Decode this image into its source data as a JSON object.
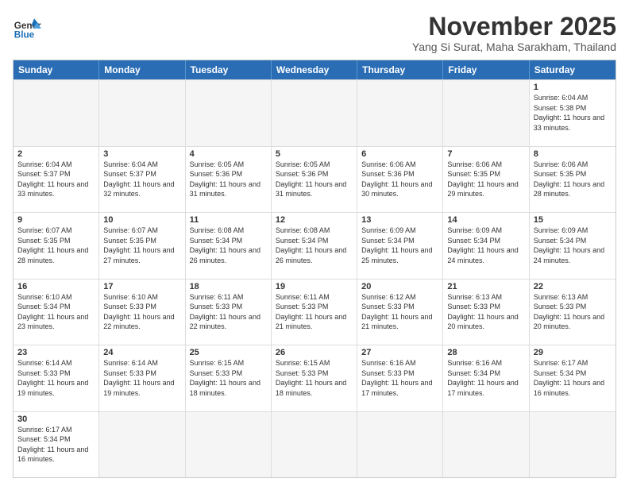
{
  "logo": {
    "general": "General",
    "blue": "Blue"
  },
  "header": {
    "month": "November 2025",
    "location": "Yang Si Surat, Maha Sarakham, Thailand"
  },
  "days": [
    "Sunday",
    "Monday",
    "Tuesday",
    "Wednesday",
    "Thursday",
    "Friday",
    "Saturday"
  ],
  "rows": [
    [
      {
        "day": "",
        "info": ""
      },
      {
        "day": "",
        "info": ""
      },
      {
        "day": "",
        "info": ""
      },
      {
        "day": "",
        "info": ""
      },
      {
        "day": "",
        "info": ""
      },
      {
        "day": "",
        "info": ""
      },
      {
        "day": "1",
        "info": "Sunrise: 6:04 AM\nSunset: 5:38 PM\nDaylight: 11 hours and 33 minutes."
      }
    ],
    [
      {
        "day": "2",
        "info": "Sunrise: 6:04 AM\nSunset: 5:37 PM\nDaylight: 11 hours and 33 minutes."
      },
      {
        "day": "3",
        "info": "Sunrise: 6:04 AM\nSunset: 5:37 PM\nDaylight: 11 hours and 32 minutes."
      },
      {
        "day": "4",
        "info": "Sunrise: 6:05 AM\nSunset: 5:36 PM\nDaylight: 11 hours and 31 minutes."
      },
      {
        "day": "5",
        "info": "Sunrise: 6:05 AM\nSunset: 5:36 PM\nDaylight: 11 hours and 31 minutes."
      },
      {
        "day": "6",
        "info": "Sunrise: 6:06 AM\nSunset: 5:36 PM\nDaylight: 11 hours and 30 minutes."
      },
      {
        "day": "7",
        "info": "Sunrise: 6:06 AM\nSunset: 5:35 PM\nDaylight: 11 hours and 29 minutes."
      },
      {
        "day": "8",
        "info": "Sunrise: 6:06 AM\nSunset: 5:35 PM\nDaylight: 11 hours and 28 minutes."
      }
    ],
    [
      {
        "day": "9",
        "info": "Sunrise: 6:07 AM\nSunset: 5:35 PM\nDaylight: 11 hours and 28 minutes."
      },
      {
        "day": "10",
        "info": "Sunrise: 6:07 AM\nSunset: 5:35 PM\nDaylight: 11 hours and 27 minutes."
      },
      {
        "day": "11",
        "info": "Sunrise: 6:08 AM\nSunset: 5:34 PM\nDaylight: 11 hours and 26 minutes."
      },
      {
        "day": "12",
        "info": "Sunrise: 6:08 AM\nSunset: 5:34 PM\nDaylight: 11 hours and 26 minutes."
      },
      {
        "day": "13",
        "info": "Sunrise: 6:09 AM\nSunset: 5:34 PM\nDaylight: 11 hours and 25 minutes."
      },
      {
        "day": "14",
        "info": "Sunrise: 6:09 AM\nSunset: 5:34 PM\nDaylight: 11 hours and 24 minutes."
      },
      {
        "day": "15",
        "info": "Sunrise: 6:09 AM\nSunset: 5:34 PM\nDaylight: 11 hours and 24 minutes."
      }
    ],
    [
      {
        "day": "16",
        "info": "Sunrise: 6:10 AM\nSunset: 5:34 PM\nDaylight: 11 hours and 23 minutes."
      },
      {
        "day": "17",
        "info": "Sunrise: 6:10 AM\nSunset: 5:33 PM\nDaylight: 11 hours and 22 minutes."
      },
      {
        "day": "18",
        "info": "Sunrise: 6:11 AM\nSunset: 5:33 PM\nDaylight: 11 hours and 22 minutes."
      },
      {
        "day": "19",
        "info": "Sunrise: 6:11 AM\nSunset: 5:33 PM\nDaylight: 11 hours and 21 minutes."
      },
      {
        "day": "20",
        "info": "Sunrise: 6:12 AM\nSunset: 5:33 PM\nDaylight: 11 hours and 21 minutes."
      },
      {
        "day": "21",
        "info": "Sunrise: 6:13 AM\nSunset: 5:33 PM\nDaylight: 11 hours and 20 minutes."
      },
      {
        "day": "22",
        "info": "Sunrise: 6:13 AM\nSunset: 5:33 PM\nDaylight: 11 hours and 20 minutes."
      }
    ],
    [
      {
        "day": "23",
        "info": "Sunrise: 6:14 AM\nSunset: 5:33 PM\nDaylight: 11 hours and 19 minutes."
      },
      {
        "day": "24",
        "info": "Sunrise: 6:14 AM\nSunset: 5:33 PM\nDaylight: 11 hours and 19 minutes."
      },
      {
        "day": "25",
        "info": "Sunrise: 6:15 AM\nSunset: 5:33 PM\nDaylight: 11 hours and 18 minutes."
      },
      {
        "day": "26",
        "info": "Sunrise: 6:15 AM\nSunset: 5:33 PM\nDaylight: 11 hours and 18 minutes."
      },
      {
        "day": "27",
        "info": "Sunrise: 6:16 AM\nSunset: 5:33 PM\nDaylight: 11 hours and 17 minutes."
      },
      {
        "day": "28",
        "info": "Sunrise: 6:16 AM\nSunset: 5:34 PM\nDaylight: 11 hours and 17 minutes."
      },
      {
        "day": "29",
        "info": "Sunrise: 6:17 AM\nSunset: 5:34 PM\nDaylight: 11 hours and 16 minutes."
      }
    ],
    [
      {
        "day": "30",
        "info": "Sunrise: 6:17 AM\nSunset: 5:34 PM\nDaylight: 11 hours and 16 minutes."
      },
      {
        "day": "",
        "info": ""
      },
      {
        "day": "",
        "info": ""
      },
      {
        "day": "",
        "info": ""
      },
      {
        "day": "",
        "info": ""
      },
      {
        "day": "",
        "info": ""
      },
      {
        "day": "",
        "info": ""
      }
    ]
  ]
}
